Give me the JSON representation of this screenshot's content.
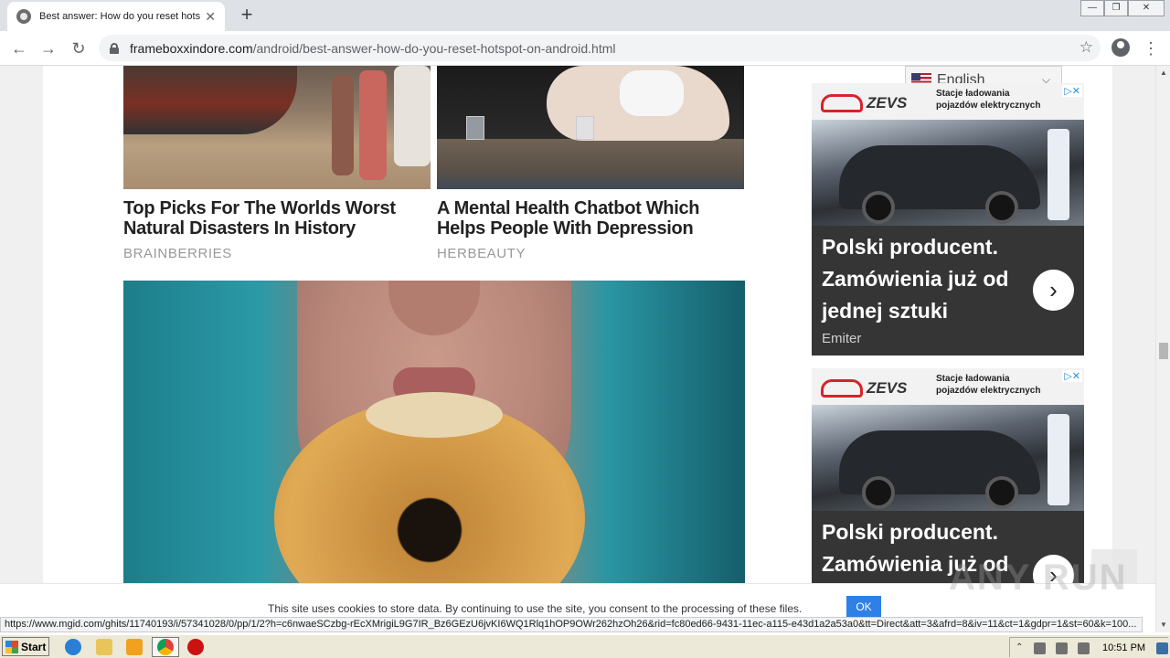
{
  "browser": {
    "tab_title": "Best answer: How do you reset hots",
    "new_tab_symbol": "+",
    "close_symbol": "✕",
    "url_host": "frameboxxindore.com",
    "url_path": "/android/best-answer-how-do-you-reset-hotspot-on-android.html",
    "window_controls": [
      "—",
      "❐",
      "✕"
    ]
  },
  "articles": [
    {
      "title_line1": "Top Picks For The Worlds Worst",
      "title_line2": "Natural Disasters In History",
      "source": "BRAINBERRIES"
    },
    {
      "title_line1": "A Mental Health Chatbot Which",
      "title_line2": "Helps People With Depression",
      "source": "HERBEAUTY"
    }
  ],
  "translate": {
    "language": "English"
  },
  "ads": [
    {
      "brand": "ZEVS",
      "caption_line1": "Stacje ładowania",
      "caption_line2": "pojazdów elektrycznych",
      "headline_line1": "Polski producent.",
      "headline_line2": "Zamówienia już od",
      "headline_line3": "jednej sztuki",
      "sponsor": "Emiter",
      "adchoice": "▷✕"
    },
    {
      "brand": "ZEVS",
      "caption_line1": "Stacje ładowania",
      "caption_line2": "pojazdów elektrycznych",
      "headline_line1": "Polski producent.",
      "headline_line2": "Zamówienia już od",
      "adchoice": "▷✕"
    }
  ],
  "cookie": {
    "text": "This site uses cookies to store data. By continuing to use the site, you consent to the processing of these files.",
    "ok_label": "OK"
  },
  "status_url": "https://www.mgid.com/ghits/11740193/i/57341028/0/pp/1/2?h=c6nwaeSCzbg-rEcXMrigiL9G7IR_Bz6GEzU6jvKI6WQ1Rlq1hOP9OWr262hzOh26&rid=fc80ed66-9431-11ec-a115-e43d1a2a53a0&tt=Direct&att=3&afrd=8&iv=11&ct=1&gdpr=1&st=60&k=100...",
  "watermark": "ANY RUN",
  "taskbar": {
    "start_label": "Start",
    "clock": "10:51 PM"
  }
}
